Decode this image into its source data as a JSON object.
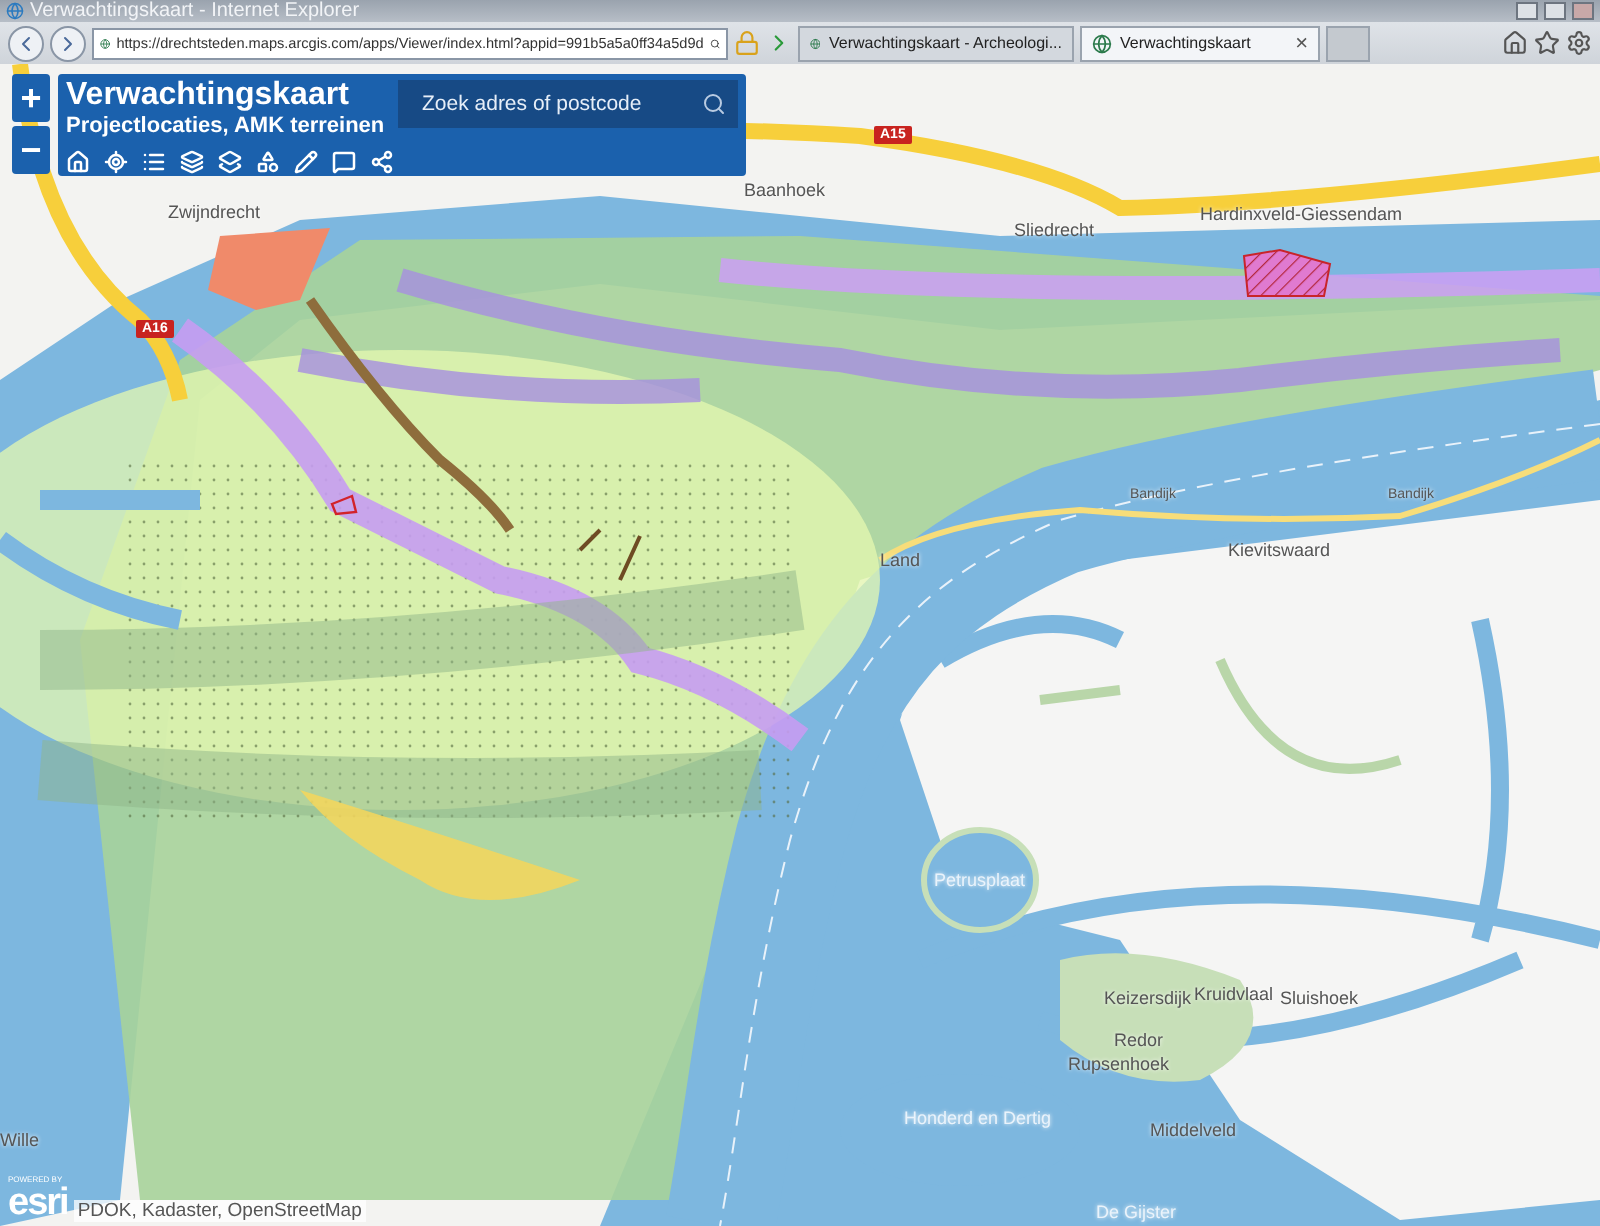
{
  "window": {
    "title": "Verwachtingskaart - Internet Explorer"
  },
  "address_bar": {
    "url": "https://drechtsteden.maps.arcgis.com/apps/Viewer/index.html?appid=991b5a5a0ff34a5d9d"
  },
  "tabs": [
    {
      "label": "Verwachtingskaart - Archeologi...",
      "selected": false
    },
    {
      "label": "Verwachtingskaart",
      "selected": true,
      "close": "×"
    }
  ],
  "zoom": {
    "in": "+",
    "out": "−"
  },
  "app_header": {
    "title": "Verwachtingskaart",
    "subtitle": "Projectlocaties, AMK terreinen",
    "search": {
      "placeholder": "Zoek adres of postcode"
    }
  },
  "map_labels": [
    {
      "text": "Zwijndrecht",
      "kind": "place"
    },
    {
      "text": "Baanhoek",
      "kind": "place"
    },
    {
      "text": "Sliedrecht",
      "kind": "place"
    },
    {
      "text": "Hardinxveld-Giessendam",
      "kind": "place"
    },
    {
      "text": "A15",
      "kind": "shield"
    },
    {
      "text": "A16",
      "kind": "shield"
    },
    {
      "text": "Kievitswaard",
      "kind": "place"
    },
    {
      "text": "Bandijk",
      "kind": "road"
    },
    {
      "text": "Bandijk",
      "kind": "road"
    },
    {
      "text": "Land",
      "kind": "place"
    },
    {
      "text": "Petrusplaat",
      "kind": "water"
    },
    {
      "text": "Keizersdijk",
      "kind": "place"
    },
    {
      "text": "Kruidvlaal",
      "kind": "place"
    },
    {
      "text": "Sluishoek",
      "kind": "place"
    },
    {
      "text": "Redor",
      "kind": "place"
    },
    {
      "text": "Rupsenhoek",
      "kind": "place"
    },
    {
      "text": "Honderd en Dertig",
      "kind": "water"
    },
    {
      "text": "Middelveld",
      "kind": "place"
    },
    {
      "text": "De Gijster",
      "kind": "water"
    },
    {
      "text": "Wille",
      "kind": "place"
    }
  ],
  "attribution": {
    "powered_by": "POWERED BY",
    "logo": "esri",
    "text": "PDOK, Kadaster, OpenStreetMap"
  }
}
